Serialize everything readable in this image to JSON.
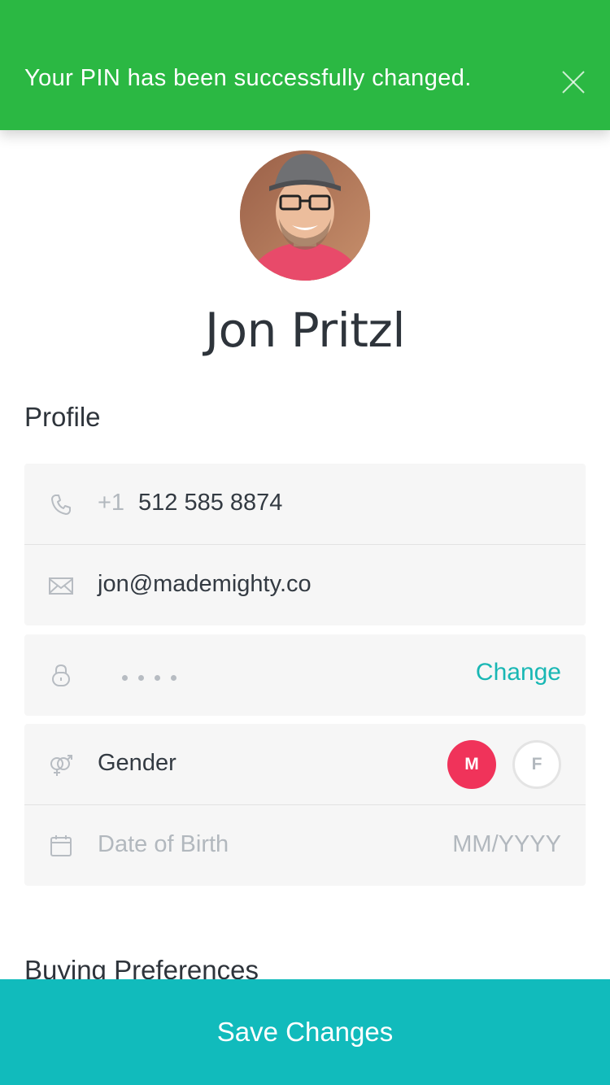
{
  "toast": {
    "message": "Your PIN has been successfully changed.",
    "close_icon": "close-icon",
    "color": "#2bb843"
  },
  "profile": {
    "name": "Jon Pritzl",
    "avatar_icon": "user-avatar-photo"
  },
  "sections": {
    "profile_title": "Profile",
    "buying_title": "Buying Preferences"
  },
  "fields": {
    "phone": {
      "icon": "phone-icon",
      "country_code": "+1",
      "value": "512 585 8874"
    },
    "email": {
      "icon": "mail-icon",
      "value": "jon@mademighty.co"
    },
    "pin": {
      "icon": "lock-icon",
      "masked_value": "••••",
      "action_label": "Change"
    },
    "gender": {
      "icon": "gender-icon",
      "label": "Gender",
      "options": [
        "M",
        "F"
      ],
      "selected": "M"
    },
    "dob": {
      "icon": "calendar-icon",
      "label": "Date of Birth",
      "placeholder": "MM/YYYY"
    }
  },
  "save_button": {
    "label": "Save Changes",
    "color": "#11bbbc"
  },
  "colors": {
    "accent": "#19b7b4",
    "selected_gender": "#f0335a",
    "card_bg": "#f6f6f6"
  }
}
